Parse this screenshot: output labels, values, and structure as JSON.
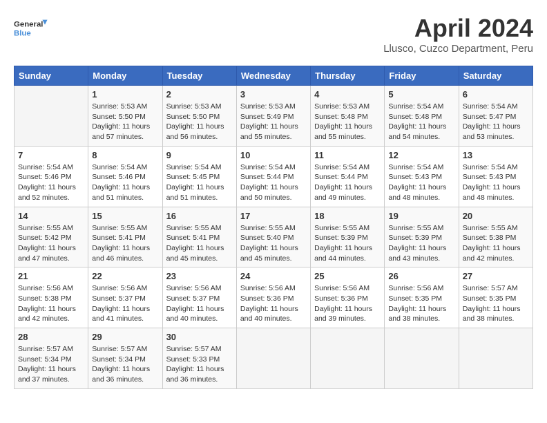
{
  "header": {
    "logo_general": "General",
    "logo_blue": "Blue",
    "title": "April 2024",
    "subtitle": "Llusco, Cuzco Department, Peru"
  },
  "weekdays": [
    "Sunday",
    "Monday",
    "Tuesday",
    "Wednesday",
    "Thursday",
    "Friday",
    "Saturday"
  ],
  "weeks": [
    [
      {
        "day": "",
        "info": ""
      },
      {
        "day": "1",
        "info": "Sunrise: 5:53 AM\nSunset: 5:50 PM\nDaylight: 11 hours\nand 57 minutes."
      },
      {
        "day": "2",
        "info": "Sunrise: 5:53 AM\nSunset: 5:50 PM\nDaylight: 11 hours\nand 56 minutes."
      },
      {
        "day": "3",
        "info": "Sunrise: 5:53 AM\nSunset: 5:49 PM\nDaylight: 11 hours\nand 55 minutes."
      },
      {
        "day": "4",
        "info": "Sunrise: 5:53 AM\nSunset: 5:48 PM\nDaylight: 11 hours\nand 55 minutes."
      },
      {
        "day": "5",
        "info": "Sunrise: 5:54 AM\nSunset: 5:48 PM\nDaylight: 11 hours\nand 54 minutes."
      },
      {
        "day": "6",
        "info": "Sunrise: 5:54 AM\nSunset: 5:47 PM\nDaylight: 11 hours\nand 53 minutes."
      }
    ],
    [
      {
        "day": "7",
        "info": "Sunrise: 5:54 AM\nSunset: 5:46 PM\nDaylight: 11 hours\nand 52 minutes."
      },
      {
        "day": "8",
        "info": "Sunrise: 5:54 AM\nSunset: 5:46 PM\nDaylight: 11 hours\nand 51 minutes."
      },
      {
        "day": "9",
        "info": "Sunrise: 5:54 AM\nSunset: 5:45 PM\nDaylight: 11 hours\nand 51 minutes."
      },
      {
        "day": "10",
        "info": "Sunrise: 5:54 AM\nSunset: 5:44 PM\nDaylight: 11 hours\nand 50 minutes."
      },
      {
        "day": "11",
        "info": "Sunrise: 5:54 AM\nSunset: 5:44 PM\nDaylight: 11 hours\nand 49 minutes."
      },
      {
        "day": "12",
        "info": "Sunrise: 5:54 AM\nSunset: 5:43 PM\nDaylight: 11 hours\nand 48 minutes."
      },
      {
        "day": "13",
        "info": "Sunrise: 5:54 AM\nSunset: 5:43 PM\nDaylight: 11 hours\nand 48 minutes."
      }
    ],
    [
      {
        "day": "14",
        "info": "Sunrise: 5:55 AM\nSunset: 5:42 PM\nDaylight: 11 hours\nand 47 minutes."
      },
      {
        "day": "15",
        "info": "Sunrise: 5:55 AM\nSunset: 5:41 PM\nDaylight: 11 hours\nand 46 minutes."
      },
      {
        "day": "16",
        "info": "Sunrise: 5:55 AM\nSunset: 5:41 PM\nDaylight: 11 hours\nand 45 minutes."
      },
      {
        "day": "17",
        "info": "Sunrise: 5:55 AM\nSunset: 5:40 PM\nDaylight: 11 hours\nand 45 minutes."
      },
      {
        "day": "18",
        "info": "Sunrise: 5:55 AM\nSunset: 5:39 PM\nDaylight: 11 hours\nand 44 minutes."
      },
      {
        "day": "19",
        "info": "Sunrise: 5:55 AM\nSunset: 5:39 PM\nDaylight: 11 hours\nand 43 minutes."
      },
      {
        "day": "20",
        "info": "Sunrise: 5:55 AM\nSunset: 5:38 PM\nDaylight: 11 hours\nand 42 minutes."
      }
    ],
    [
      {
        "day": "21",
        "info": "Sunrise: 5:56 AM\nSunset: 5:38 PM\nDaylight: 11 hours\nand 42 minutes."
      },
      {
        "day": "22",
        "info": "Sunrise: 5:56 AM\nSunset: 5:37 PM\nDaylight: 11 hours\nand 41 minutes."
      },
      {
        "day": "23",
        "info": "Sunrise: 5:56 AM\nSunset: 5:37 PM\nDaylight: 11 hours\nand 40 minutes."
      },
      {
        "day": "24",
        "info": "Sunrise: 5:56 AM\nSunset: 5:36 PM\nDaylight: 11 hours\nand 40 minutes."
      },
      {
        "day": "25",
        "info": "Sunrise: 5:56 AM\nSunset: 5:36 PM\nDaylight: 11 hours\nand 39 minutes."
      },
      {
        "day": "26",
        "info": "Sunrise: 5:56 AM\nSunset: 5:35 PM\nDaylight: 11 hours\nand 38 minutes."
      },
      {
        "day": "27",
        "info": "Sunrise: 5:57 AM\nSunset: 5:35 PM\nDaylight: 11 hours\nand 38 minutes."
      }
    ],
    [
      {
        "day": "28",
        "info": "Sunrise: 5:57 AM\nSunset: 5:34 PM\nDaylight: 11 hours\nand 37 minutes."
      },
      {
        "day": "29",
        "info": "Sunrise: 5:57 AM\nSunset: 5:34 PM\nDaylight: 11 hours\nand 36 minutes."
      },
      {
        "day": "30",
        "info": "Sunrise: 5:57 AM\nSunset: 5:33 PM\nDaylight: 11 hours\nand 36 minutes."
      },
      {
        "day": "",
        "info": ""
      },
      {
        "day": "",
        "info": ""
      },
      {
        "day": "",
        "info": ""
      },
      {
        "day": "",
        "info": ""
      }
    ]
  ]
}
